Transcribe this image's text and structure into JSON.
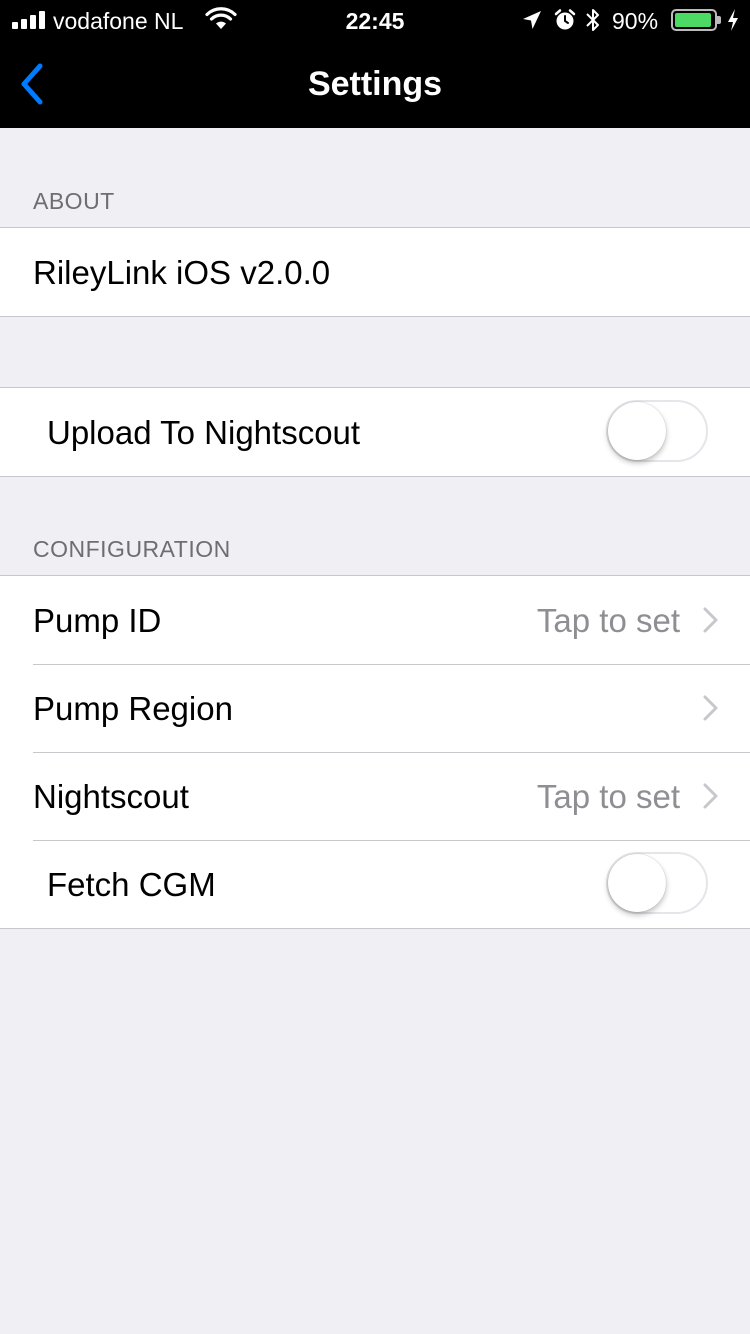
{
  "status_bar": {
    "carrier": "vodafone NL",
    "time": "22:45",
    "battery_percent": "90%",
    "battery_level": 0.9,
    "icons": [
      "signal-icon",
      "wifi-icon",
      "location-arrow-icon",
      "alarm-icon",
      "bluetooth-icon",
      "battery-icon",
      "charging-icon"
    ]
  },
  "nav": {
    "title": "Settings",
    "back_icon": "chevron-left-icon"
  },
  "colors": {
    "accent": "#007aff",
    "background": "#efeff4",
    "separator": "#c8c7cc",
    "detail_text": "#8e8e93",
    "battery_fill": "#4cd964"
  },
  "sections": {
    "about": {
      "header": "ABOUT",
      "rows": [
        {
          "label": "RileyLink iOS v2.0.0"
        }
      ]
    },
    "upload": {
      "rows": [
        {
          "label": "Upload To Nightscout",
          "toggle": false
        }
      ]
    },
    "configuration": {
      "header": "CONFIGURATION",
      "rows": [
        {
          "label": "Pump ID",
          "detail": "Tap to set",
          "disclosure": true
        },
        {
          "label": "Pump Region",
          "detail": "",
          "disclosure": true
        },
        {
          "label": "Nightscout",
          "detail": "Tap to set",
          "disclosure": true
        },
        {
          "label": "Fetch CGM",
          "toggle": false
        }
      ]
    }
  }
}
